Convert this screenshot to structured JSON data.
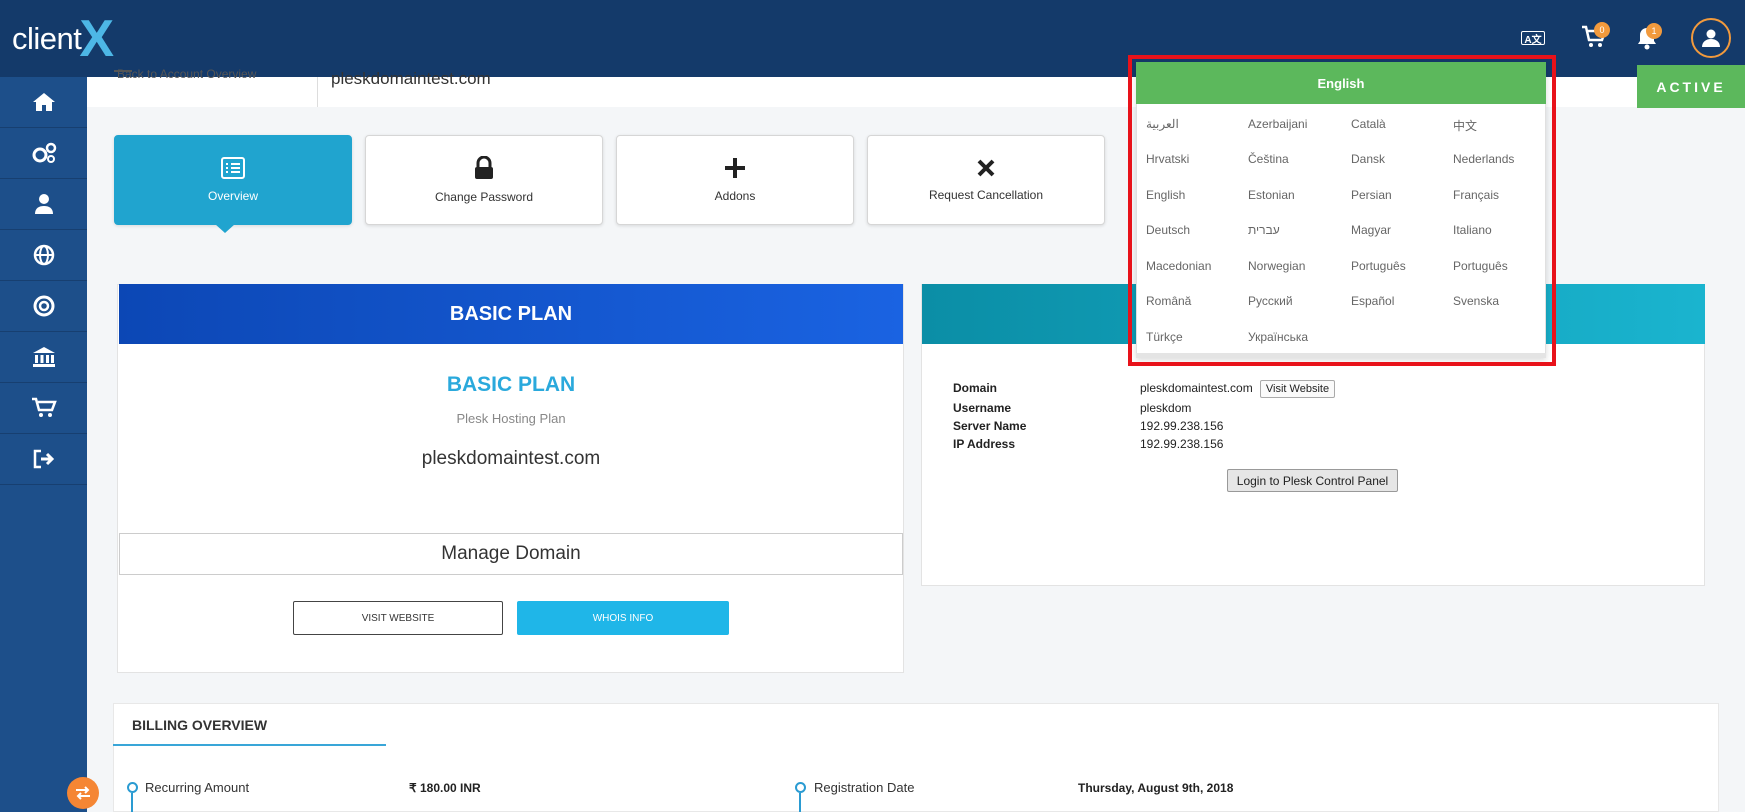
{
  "header": {
    "logo_text": "client",
    "logo_mark": "X",
    "cart_count": "0",
    "notification_count": "1",
    "icons": [
      "language-icon",
      "cart-icon",
      "bell-icon",
      "user-avatar-icon"
    ],
    "accent_color": "#f29a3d"
  },
  "sidebar": {
    "items": [
      {
        "icon": "home-icon"
      },
      {
        "icon": "gears-icon"
      },
      {
        "icon": "user-icon"
      },
      {
        "icon": "globe-icon"
      },
      {
        "icon": "lifebuoy-icon"
      },
      {
        "icon": "bank-icon"
      },
      {
        "icon": "cart-icon"
      },
      {
        "icon": "logout-icon"
      }
    ]
  },
  "subheader": {
    "back_label": "Back to Account Overview",
    "domain": "pleskdomaintest.com",
    "status": "ACTIVE"
  },
  "tabs": [
    {
      "label": "Overview",
      "icon": "list-icon",
      "active": true
    },
    {
      "label": "Change Password",
      "icon": "lock-icon",
      "active": false
    },
    {
      "label": "Addons",
      "icon": "plus-icon",
      "active": false
    },
    {
      "label": "Request Cancellation",
      "icon": "times-icon",
      "active": false
    }
  ],
  "plan": {
    "header": "BASIC PLAN",
    "name": "BASIC PLAN",
    "type": "Plesk Hosting Plan",
    "domain": "pleskdomaintest.com",
    "manage_label": "Manage Domain",
    "visit_label": "VISIT WEBSITE",
    "whois_label": "WHOIS INFO"
  },
  "details": {
    "rows": [
      {
        "label": "Domain",
        "value": "pleskdomaintest.com"
      },
      {
        "label": "Username",
        "value": "pleskdom"
      },
      {
        "label": "Server Name",
        "value": "192.99.238.156"
      },
      {
        "label": "IP Address",
        "value": "192.99.238.156"
      }
    ],
    "visit_label": "Visit Website",
    "login_label": "Login to Plesk Control Panel"
  },
  "billing": {
    "title": "BILLING OVERVIEW",
    "recurring_label": "Recurring Amount",
    "recurring_value": "₹ 180.00 INR",
    "registration_label": "Registration Date",
    "registration_value": "Thursday, August 9th, 2018"
  },
  "language": {
    "current": "English",
    "options": [
      "العربية",
      "Azerbaijani",
      "Català",
      "中文",
      "Hrvatski",
      "Čeština",
      "Dansk",
      "Nederlands",
      "English",
      "Estonian",
      "Persian",
      "Français",
      "Deutsch",
      "עברית",
      "Magyar",
      "Italiano",
      "Macedonian",
      "Norwegian",
      "Português",
      "Português",
      "Română",
      "Русский",
      "Español",
      "Svenska",
      "Türkçe",
      "Українська"
    ]
  },
  "colors": {
    "header_bg": "#143a6a",
    "sidebar_bg": "#1d4f8a",
    "active_tab": "#20a4cf",
    "status_green": "#5cb85c",
    "highlight_red": "#e8121a"
  }
}
